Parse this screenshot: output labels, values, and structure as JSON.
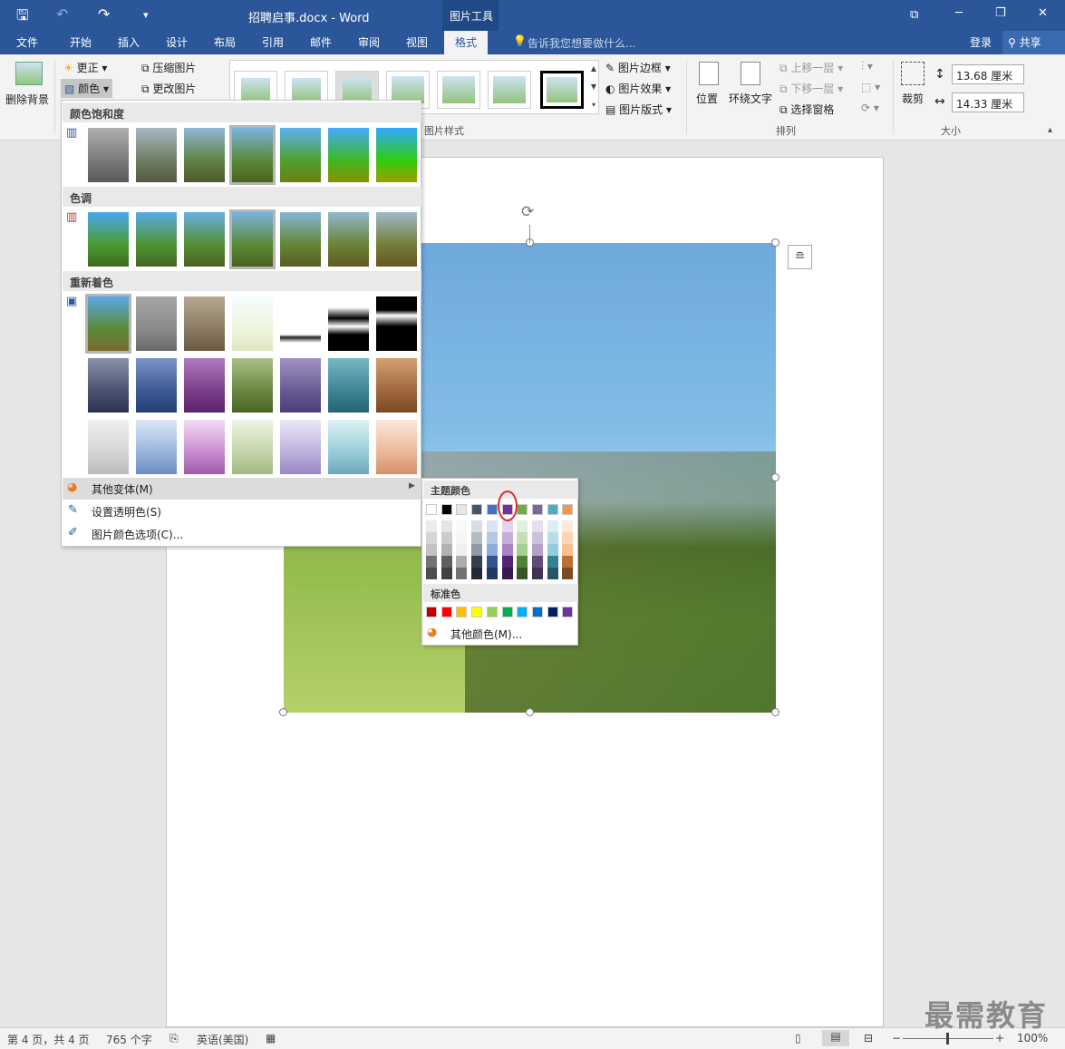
{
  "titlebar": {
    "doc_title": "招聘启事.docx - Word",
    "context_tab": "图片工具",
    "minimize": "─",
    "restore": "❐",
    "close": "✕"
  },
  "tabs": [
    "文件",
    "开始",
    "插入",
    "设计",
    "布局",
    "引用",
    "邮件",
    "审阅",
    "视图",
    "格式"
  ],
  "tell_me": "告诉我您想要做什么...",
  "signin": "登录",
  "share": "共享",
  "ribbon": {
    "remove_bg": "删除背景",
    "corrections": "更正",
    "color": "颜色",
    "compress": "压缩图片",
    "change": "更改图片",
    "picture_border": "图片边框",
    "picture_effects": "图片效果",
    "picture_layout": "图片版式",
    "styles_group": "图片样式",
    "position": "位置",
    "wrap_text": "环绕文字",
    "bring_forward": "上移一层",
    "send_backward": "下移一层",
    "selection_pane": "选择窗格",
    "arrange_group": "排列",
    "crop": "裁剪",
    "height": "13.68 厘米",
    "width": "14.33 厘米",
    "size_group": "大小"
  },
  "color_menu": {
    "saturation": "颜色饱和度",
    "tone": "色调",
    "recolor": "重新着色",
    "more_variations": "其他变体(M)",
    "set_transparent": "设置透明色(S)",
    "color_options": "图片颜色选项(C)..."
  },
  "palette": {
    "theme": "主题颜色",
    "standard": "标准色",
    "more_colors": "其他颜色(M)...",
    "theme_row": [
      "#ffffff",
      "#000000",
      "#e7e6e6",
      "#44546a",
      "#4472c4",
      "#7030a0",
      "#70ad47",
      "#8064a2",
      "#4bacc6",
      "#f79646"
    ],
    "standard_row": [
      "#c00000",
      "#ff0000",
      "#ffc000",
      "#ffff00",
      "#92d050",
      "#00b050",
      "#00b0f0",
      "#0070c0",
      "#002060",
      "#7030a0"
    ]
  },
  "status": {
    "page": "第 4 页，共 4 页",
    "words": "765 个字",
    "lang": "英语(美国)",
    "zoom": "100%"
  },
  "watermark": "最需教育"
}
